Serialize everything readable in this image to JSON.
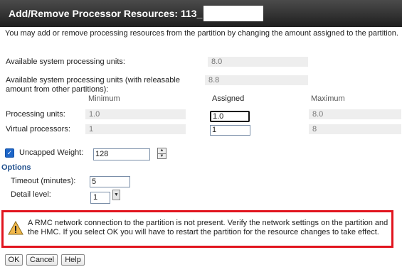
{
  "dialog": {
    "title": "Add/Remove Processor Resources: 113_",
    "intro": "You may add or remove processing resources from the partition by changing the amount assigned to the partition."
  },
  "system": {
    "available_label": "Available system processing units:",
    "available_value": "8.0",
    "releasable_label_line1": "Available system processing units (with releasable",
    "releasable_label_line2": "amount from other partitions):",
    "releasable_value": "8.8"
  },
  "columns": {
    "minimum": "Minimum",
    "assigned": "Assigned",
    "maximum": "Maximum"
  },
  "processing_units": {
    "label": "Processing units:",
    "minimum": "1.0",
    "assigned": "1.0",
    "maximum": "8.0"
  },
  "virtual_processors": {
    "label": "Virtual processors:",
    "minimum": "1",
    "assigned": "1",
    "maximum": "8"
  },
  "uncapped": {
    "label": "Uncapped Weight:",
    "checked": true,
    "value": "128"
  },
  "options": {
    "header": "Options",
    "timeout_label": "Timeout (minutes):",
    "timeout_value": "5",
    "detail_label": "Detail level:",
    "detail_value": "1"
  },
  "alert": {
    "icon": "warning-icon",
    "message": "A RMC network connection to the partition is not present. Verify the network settings on the partition and the HMC. If you select OK you will have to restart the partition for the resource changes to take effect.",
    "border_color": "#e1141e"
  },
  "buttons": {
    "ok": "OK",
    "cancel": "Cancel",
    "help": "Help"
  }
}
